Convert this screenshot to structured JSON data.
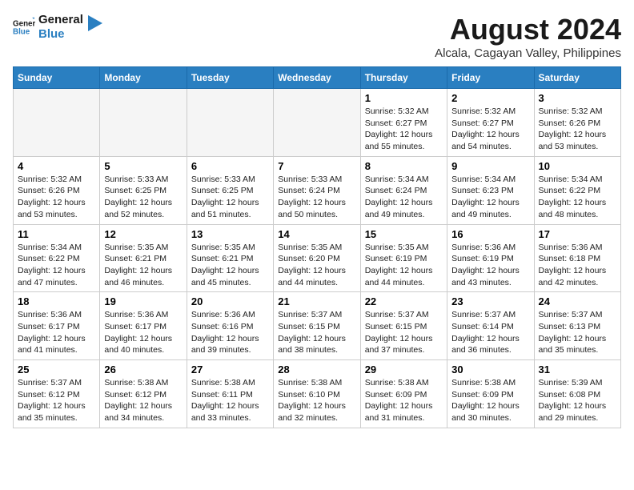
{
  "header": {
    "logo_line1": "General",
    "logo_line2": "Blue",
    "title": "August 2024",
    "subtitle": "Alcala, Cagayan Valley, Philippines"
  },
  "weekdays": [
    "Sunday",
    "Monday",
    "Tuesday",
    "Wednesday",
    "Thursday",
    "Friday",
    "Saturday"
  ],
  "weeks": [
    [
      {
        "day": "",
        "info": ""
      },
      {
        "day": "",
        "info": ""
      },
      {
        "day": "",
        "info": ""
      },
      {
        "day": "",
        "info": ""
      },
      {
        "day": "1",
        "info": "Sunrise: 5:32 AM\nSunset: 6:27 PM\nDaylight: 12 hours\nand 55 minutes."
      },
      {
        "day": "2",
        "info": "Sunrise: 5:32 AM\nSunset: 6:27 PM\nDaylight: 12 hours\nand 54 minutes."
      },
      {
        "day": "3",
        "info": "Sunrise: 5:32 AM\nSunset: 6:26 PM\nDaylight: 12 hours\nand 53 minutes."
      }
    ],
    [
      {
        "day": "4",
        "info": "Sunrise: 5:32 AM\nSunset: 6:26 PM\nDaylight: 12 hours\nand 53 minutes."
      },
      {
        "day": "5",
        "info": "Sunrise: 5:33 AM\nSunset: 6:25 PM\nDaylight: 12 hours\nand 52 minutes."
      },
      {
        "day": "6",
        "info": "Sunrise: 5:33 AM\nSunset: 6:25 PM\nDaylight: 12 hours\nand 51 minutes."
      },
      {
        "day": "7",
        "info": "Sunrise: 5:33 AM\nSunset: 6:24 PM\nDaylight: 12 hours\nand 50 minutes."
      },
      {
        "day": "8",
        "info": "Sunrise: 5:34 AM\nSunset: 6:24 PM\nDaylight: 12 hours\nand 49 minutes."
      },
      {
        "day": "9",
        "info": "Sunrise: 5:34 AM\nSunset: 6:23 PM\nDaylight: 12 hours\nand 49 minutes."
      },
      {
        "day": "10",
        "info": "Sunrise: 5:34 AM\nSunset: 6:22 PM\nDaylight: 12 hours\nand 48 minutes."
      }
    ],
    [
      {
        "day": "11",
        "info": "Sunrise: 5:34 AM\nSunset: 6:22 PM\nDaylight: 12 hours\nand 47 minutes."
      },
      {
        "day": "12",
        "info": "Sunrise: 5:35 AM\nSunset: 6:21 PM\nDaylight: 12 hours\nand 46 minutes."
      },
      {
        "day": "13",
        "info": "Sunrise: 5:35 AM\nSunset: 6:21 PM\nDaylight: 12 hours\nand 45 minutes."
      },
      {
        "day": "14",
        "info": "Sunrise: 5:35 AM\nSunset: 6:20 PM\nDaylight: 12 hours\nand 44 minutes."
      },
      {
        "day": "15",
        "info": "Sunrise: 5:35 AM\nSunset: 6:19 PM\nDaylight: 12 hours\nand 44 minutes."
      },
      {
        "day": "16",
        "info": "Sunrise: 5:36 AM\nSunset: 6:19 PM\nDaylight: 12 hours\nand 43 minutes."
      },
      {
        "day": "17",
        "info": "Sunrise: 5:36 AM\nSunset: 6:18 PM\nDaylight: 12 hours\nand 42 minutes."
      }
    ],
    [
      {
        "day": "18",
        "info": "Sunrise: 5:36 AM\nSunset: 6:17 PM\nDaylight: 12 hours\nand 41 minutes."
      },
      {
        "day": "19",
        "info": "Sunrise: 5:36 AM\nSunset: 6:17 PM\nDaylight: 12 hours\nand 40 minutes."
      },
      {
        "day": "20",
        "info": "Sunrise: 5:36 AM\nSunset: 6:16 PM\nDaylight: 12 hours\nand 39 minutes."
      },
      {
        "day": "21",
        "info": "Sunrise: 5:37 AM\nSunset: 6:15 PM\nDaylight: 12 hours\nand 38 minutes."
      },
      {
        "day": "22",
        "info": "Sunrise: 5:37 AM\nSunset: 6:15 PM\nDaylight: 12 hours\nand 37 minutes."
      },
      {
        "day": "23",
        "info": "Sunrise: 5:37 AM\nSunset: 6:14 PM\nDaylight: 12 hours\nand 36 minutes."
      },
      {
        "day": "24",
        "info": "Sunrise: 5:37 AM\nSunset: 6:13 PM\nDaylight: 12 hours\nand 35 minutes."
      }
    ],
    [
      {
        "day": "25",
        "info": "Sunrise: 5:37 AM\nSunset: 6:12 PM\nDaylight: 12 hours\nand 35 minutes."
      },
      {
        "day": "26",
        "info": "Sunrise: 5:38 AM\nSunset: 6:12 PM\nDaylight: 12 hours\nand 34 minutes."
      },
      {
        "day": "27",
        "info": "Sunrise: 5:38 AM\nSunset: 6:11 PM\nDaylight: 12 hours\nand 33 minutes."
      },
      {
        "day": "28",
        "info": "Sunrise: 5:38 AM\nSunset: 6:10 PM\nDaylight: 12 hours\nand 32 minutes."
      },
      {
        "day": "29",
        "info": "Sunrise: 5:38 AM\nSunset: 6:09 PM\nDaylight: 12 hours\nand 31 minutes."
      },
      {
        "day": "30",
        "info": "Sunrise: 5:38 AM\nSunset: 6:09 PM\nDaylight: 12 hours\nand 30 minutes."
      },
      {
        "day": "31",
        "info": "Sunrise: 5:39 AM\nSunset: 6:08 PM\nDaylight: 12 hours\nand 29 minutes."
      }
    ]
  ]
}
